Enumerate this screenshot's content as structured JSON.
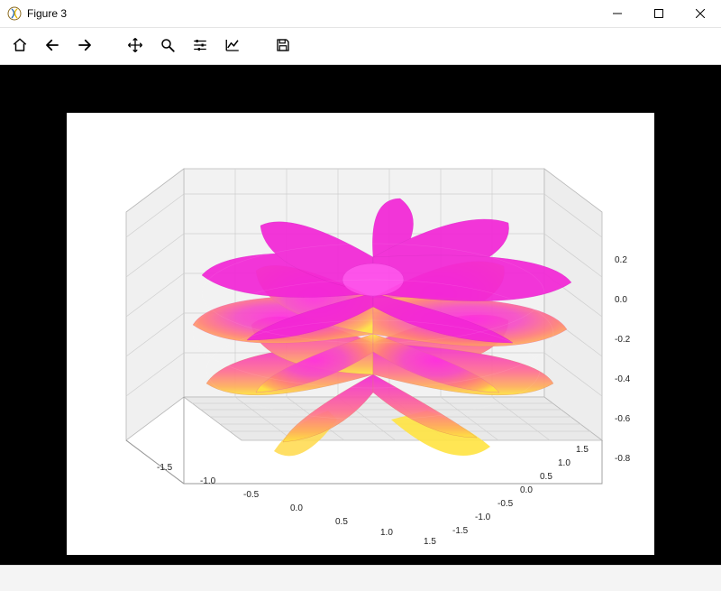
{
  "window": {
    "title": "Figure 3"
  },
  "toolbar": {
    "home_tip": "Home",
    "back_tip": "Back",
    "forward_tip": "Forward",
    "pan_tip": "Pan",
    "zoom_tip": "Zoom",
    "subplots_tip": "Configure subplots",
    "axes_tip": "Edit axis",
    "save_tip": "Save"
  },
  "chart_data": {
    "type": "surface",
    "description": "parametric 3D flower/rose surface, colored by height (magenta high to yellow low)",
    "axes": {
      "x": {
        "ticks": [
          "-1.5",
          "-1.0",
          "-0.5",
          "0.0",
          "0.5",
          "1.0",
          "1.5"
        ],
        "lim": [
          -1.5,
          1.5
        ]
      },
      "y": {
        "ticks": [
          "-1.5",
          "-1.0",
          "-0.5",
          "0.0",
          "0.5",
          "1.0",
          "1.5"
        ],
        "lim": [
          -1.5,
          1.5
        ]
      },
      "z": {
        "ticks": [
          "0.2",
          "0.0",
          "-0.2",
          "-0.4",
          "-0.6",
          "-0.8"
        ],
        "lim": [
          -0.9,
          0.3
        ]
      }
    },
    "colormap": {
      "low": "#ffe341",
      "mid": "#ff8a63",
      "high": "#f326d6"
    }
  }
}
